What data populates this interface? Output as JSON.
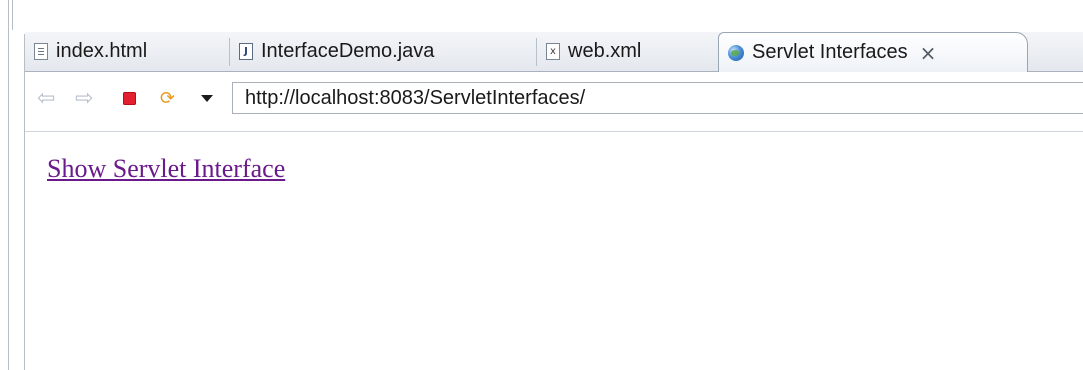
{
  "tabs": [
    {
      "label": "index.html",
      "icon": "html-file-icon",
      "active": false
    },
    {
      "label": "InterfaceDemo.java",
      "icon": "java-file-icon",
      "active": false
    },
    {
      "label": "web.xml",
      "icon": "xml-file-icon",
      "active": false
    },
    {
      "label": "Servlet Interfaces",
      "icon": "globe-icon",
      "active": true
    }
  ],
  "toolbar": {
    "icons": [
      "back-arrow-icon",
      "forward-arrow-icon",
      "stop-icon",
      "refresh-icon",
      "dropdown-icon"
    ],
    "url": "http://localhost:8083/ServletInterfaces/"
  },
  "close_glyph": "×",
  "page": {
    "link_text": "Show Servlet Interface",
    "link_color": "#6a1a8a"
  },
  "colors": {
    "stop": "#e2202f",
    "refresh": "#e79a20",
    "tab_bg": "#e4e8ee"
  }
}
